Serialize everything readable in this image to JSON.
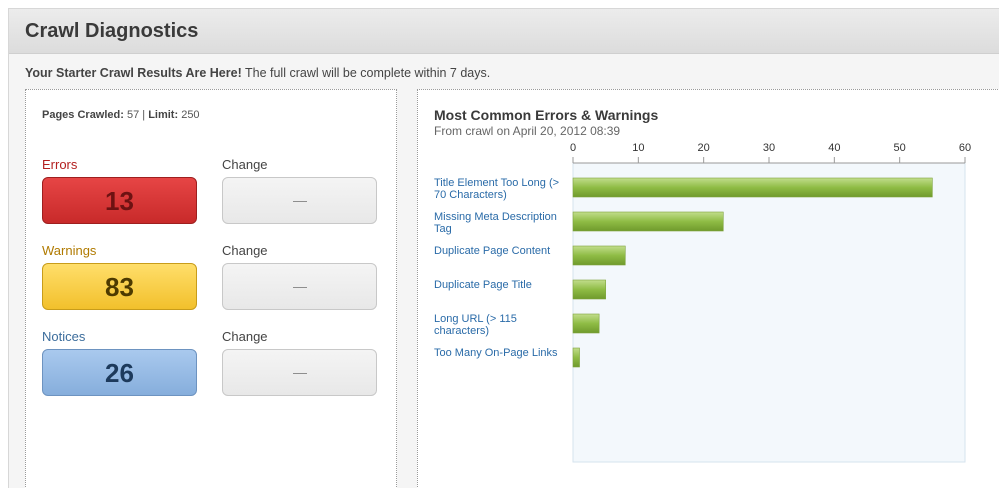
{
  "page": {
    "title": "Crawl Diagnostics"
  },
  "intro": {
    "bold": "Your Starter Crawl Results Are Here!",
    "rest": " The full crawl will be complete within 7 days."
  },
  "stats": {
    "pages_label": "Pages Crawled:",
    "pages_value": " 57 | ",
    "limit_label": "Limit:",
    "limit_value": " 250"
  },
  "metrics": [
    {
      "label": "Errors",
      "value": "13",
      "change_label": "Change",
      "change_value": "—"
    },
    {
      "label": "Warnings",
      "value": "83",
      "change_label": "Change",
      "change_value": "—"
    },
    {
      "label": "Notices",
      "value": "26",
      "change_label": "Change",
      "change_value": "—"
    }
  ],
  "colors": {
    "errors": "#d63a3a",
    "warnings": "#fcd24e",
    "notices": "#97bbe6",
    "bar": "#8fbc45",
    "link": "#2a6ba8"
  },
  "chart": {
    "title": "Most Common Errors & Warnings",
    "subtitle": "From crawl on April 20, 2012 08:39"
  },
  "chart_data": {
    "type": "bar",
    "orientation": "horizontal",
    "title": "Most Common Errors & Warnings",
    "subtitle": "From crawl on April 20, 2012 08:39",
    "categories": [
      [
        "Title Element Too Long (>",
        "70 Characters)"
      ],
      [
        "Missing Meta Description",
        "Tag"
      ],
      [
        "Duplicate Page Content"
      ],
      [
        "Duplicate Page Title"
      ],
      [
        "Long URL (> 115",
        "characters)"
      ],
      [
        "Too Many On-Page Links"
      ]
    ],
    "values": [
      55,
      23,
      8,
      5,
      4,
      1
    ],
    "xlim": [
      0,
      60
    ],
    "xticks": [
      0,
      10,
      20,
      30,
      40,
      50,
      60
    ],
    "axis_position": "top",
    "grid": false
  }
}
